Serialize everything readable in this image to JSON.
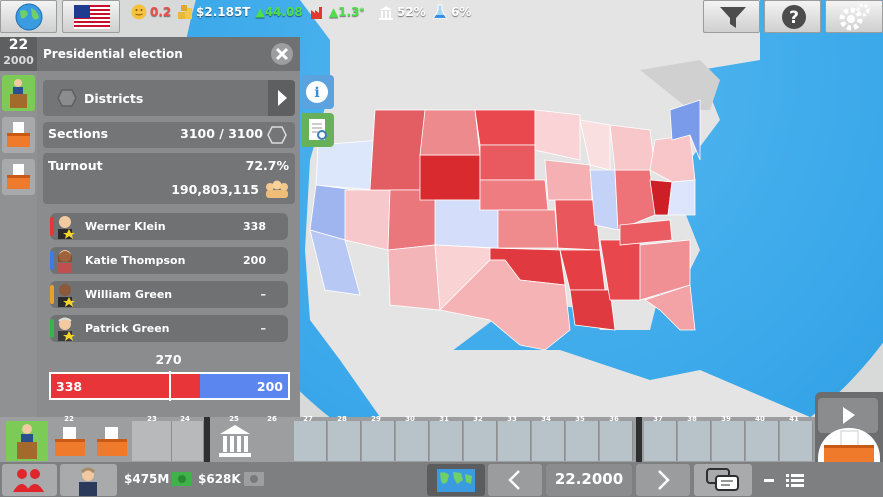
{
  "top_bar": {
    "happiness": "0.2",
    "money": "$2.185T",
    "money_change": "44.08",
    "industry": "1.3",
    "approval": "52%",
    "research": "6%",
    "icons": [
      "globe-icon",
      "us-flag-icon",
      "smiley-icon",
      "coins-icon",
      "factory-icon",
      "capitol-icon",
      "flask-icon",
      "filter-icon",
      "help-icon",
      "gear-icon"
    ]
  },
  "sidebar": {
    "date_day": "22",
    "date_year": "2000"
  },
  "election": {
    "title": "Presidential election",
    "districts_label": "Districts",
    "sections_label": "Sections",
    "sections_value": "3100 / 3100",
    "turnout_label": "Turnout",
    "turnout_pct": "72.7%",
    "turnout_count": "190,803,115",
    "candidates": [
      {
        "name": "Werner Klein",
        "votes": "338",
        "color": "#e8353a"
      },
      {
        "name": "Katie Thompson",
        "votes": "200",
        "color": "#3e7be8"
      },
      {
        "name": "William Green",
        "votes": "–",
        "color": "#e8a128"
      },
      {
        "name": "Patrick Green",
        "votes": "–",
        "color": "#35b54a"
      }
    ],
    "threshold": "270",
    "bar_left": "338",
    "bar_right": "200",
    "bar_left_fraction": 0.628,
    "colors": {
      "red": "#e8353a",
      "blue": "#5b86f0"
    }
  },
  "timeline": {
    "numbers": [
      "22",
      "23",
      "24",
      "25",
      "26",
      "27",
      "28",
      "29",
      "30",
      "31",
      "32",
      "33",
      "34",
      "35",
      "36",
      "37",
      "38",
      "39",
      "40",
      "41"
    ]
  },
  "bottom_bar": {
    "funds_a": "$475M",
    "funds_b": "$628K",
    "date": "22.2000"
  }
}
